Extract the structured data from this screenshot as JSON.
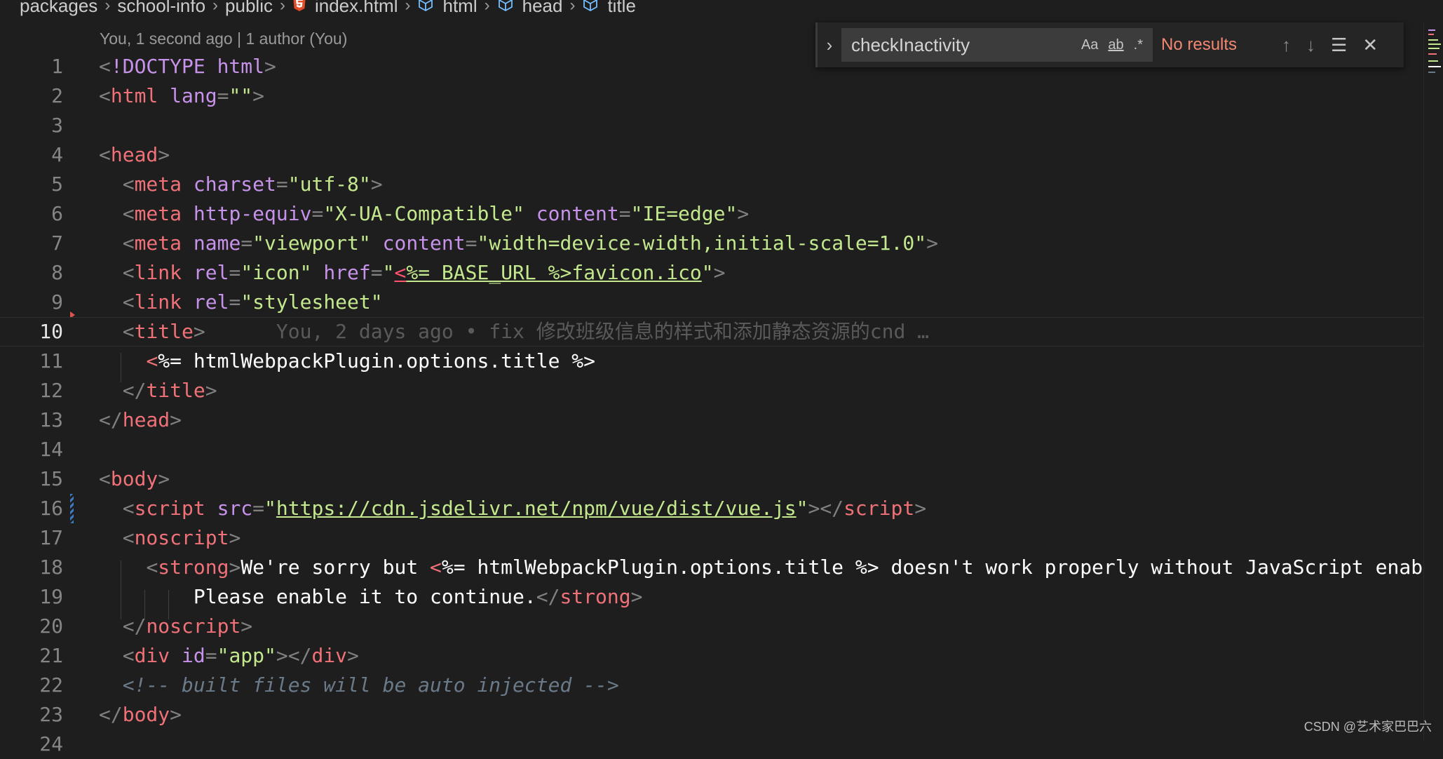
{
  "breadcrumb": {
    "items": [
      "packages",
      "school-info",
      "public",
      "index.html",
      "html",
      "head",
      "title"
    ]
  },
  "blame_header": "You, 1 second ago | 1 author (You)",
  "find_widget": {
    "query": "checkInactivity",
    "match_case_label": "Aa",
    "whole_word_label": "ab",
    "regex_label": ".*",
    "status": "No results"
  },
  "editor": {
    "active_line": 10,
    "inline_blame": "You, 2 days ago • fix 修改班级信息的样式和添加静态资源的cnd …",
    "line_numbers": [
      "1",
      "2",
      "3",
      "4",
      "5",
      "6",
      "7",
      "8",
      "9",
      "10",
      "11",
      "12",
      "13",
      "14",
      "15",
      "16",
      "17",
      "18",
      "19",
      "20",
      "21",
      "22",
      "23",
      "24"
    ]
  },
  "colors": {
    "background": "#1e1e1e",
    "tag": "#f07178",
    "attribute": "#c792ea",
    "string": "#c3e88d",
    "comment": "#6b7a89",
    "no_results": "#f48771"
  },
  "watermark": "CSDN @艺术家巴巴六"
}
